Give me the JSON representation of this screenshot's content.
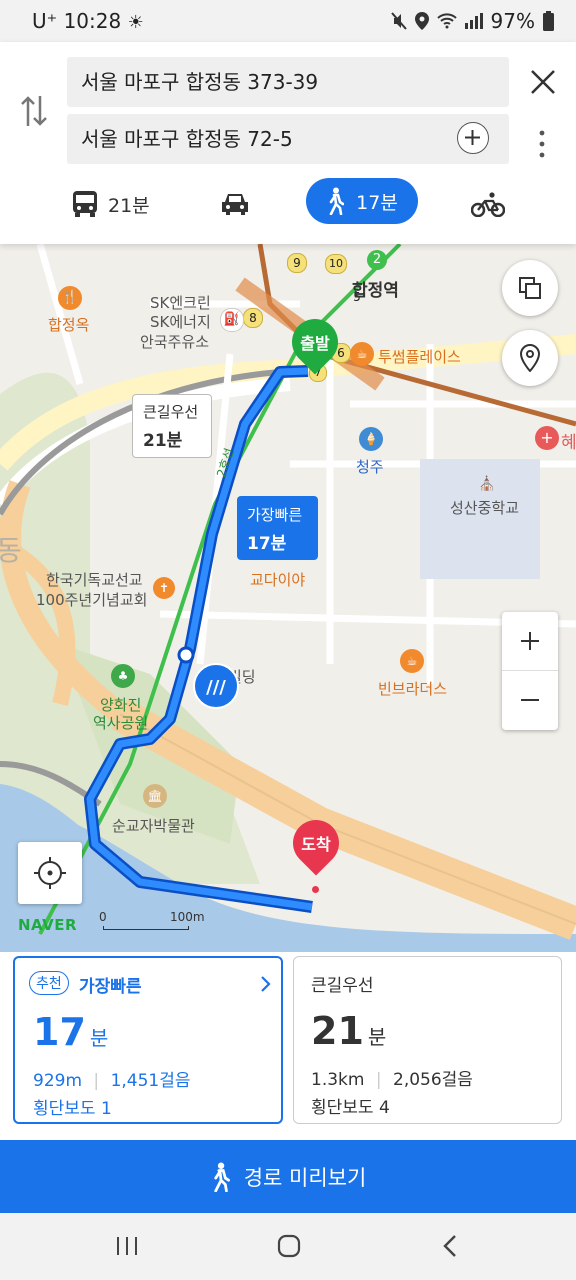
{
  "status_bar": {
    "carrier": "U⁺",
    "time": "10:28",
    "battery": "97%",
    "icons": [
      "weather-icon",
      "mute-icon",
      "location-icon",
      "wifi-icon",
      "signal-icon",
      "battery-icon"
    ]
  },
  "search": {
    "origin": "서울 마포구 합정동 373-39",
    "destination": "서울 마포구 합정동 72-5"
  },
  "modes": [
    {
      "name": "bus",
      "label": "21분"
    },
    {
      "name": "car",
      "label": ""
    },
    {
      "name": "walk",
      "label": "17분",
      "active": true
    },
    {
      "name": "bike",
      "label": ""
    }
  ],
  "map": {
    "pois": {
      "hapjeongok": "합정옥",
      "sk1": "SK엔크린",
      "sk2": "SK에너지",
      "sk3": "안국주유소",
      "hapjeong_station": "합정역",
      "twosome": "투썸플레이스",
      "cheongju": "청주",
      "seongsan": "성산중학교",
      "church1": "한국기독교선교",
      "church2": "100주년기념교회",
      "codaiya": "교다이야",
      "building": "빌딩",
      "beanbrothers": "빈브라더스",
      "yanghwajin1": "양화진",
      "yanghwajin2": "역사공원",
      "museum": "순교자박물관",
      "cut_right": "혜",
      "road": "2호선",
      "side_dong": "동"
    },
    "station_numbers": [
      "9",
      "10",
      "2",
      "8",
      "5",
      "6",
      "7"
    ],
    "start_label": "출발",
    "end_label": "도착",
    "alt_bubble": {
      "title": "큰길우선",
      "time": "21분"
    },
    "main_bubble": {
      "title": "가장빠른",
      "time": "17분"
    },
    "scale": {
      "zero": "0",
      "distance": "100m"
    },
    "brand": "NAVER"
  },
  "routes": [
    {
      "badge": "추천",
      "label": "가장빠른",
      "minutes": "17",
      "unit": "분",
      "distance": "929m",
      "steps": "1,451걸음",
      "crossings": "횡단보도 1"
    },
    {
      "label": "큰길우선",
      "minutes": "21",
      "unit": "분",
      "distance": "1.3km",
      "steps": "2,056걸음",
      "crossings": "횡단보도 4"
    }
  ],
  "preview_label": "경로 미리보기",
  "colors": {
    "accent": "#1a73e8",
    "start": "#1fab3f",
    "end": "#e8364f"
  }
}
